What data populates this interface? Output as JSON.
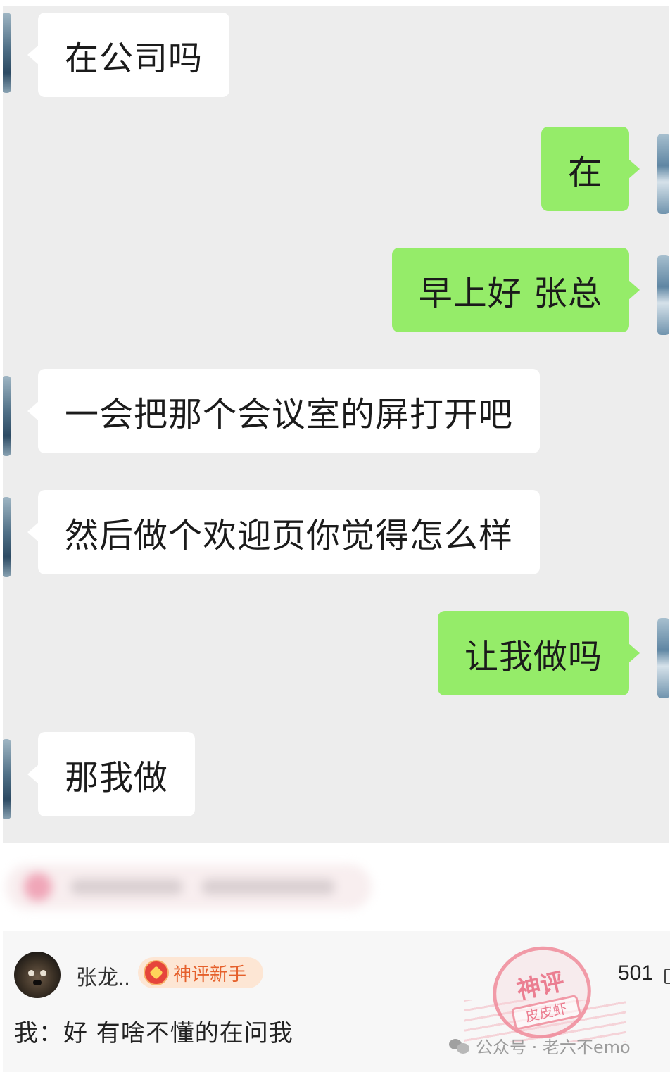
{
  "chat": {
    "messages": [
      {
        "side": "in",
        "text": "在公司吗"
      },
      {
        "side": "out",
        "text": "在"
      },
      {
        "side": "out",
        "text": "早上好 张总"
      },
      {
        "side": "in",
        "text": "一会把那个会议室的屏打开吧"
      },
      {
        "side": "in",
        "text": "然后做个欢迎页你觉得怎么样"
      },
      {
        "side": "out",
        "text": "让我做吗"
      },
      {
        "side": "in",
        "text": "那我做"
      }
    ],
    "colors": {
      "background": "#ededed",
      "incoming": "#ffffff",
      "outgoing": "#95ec69"
    }
  },
  "comment": {
    "username": "张龙..",
    "badge": "神评新手",
    "likes": "501",
    "text": "我：好 有啥不懂的在问我",
    "badge_color": "#e5602b"
  },
  "stamp": {
    "top": "神评",
    "band": "皮皮虾"
  },
  "watermark": {
    "text": "公众号 · 老六不emo",
    "icon": "wechat-icon"
  }
}
